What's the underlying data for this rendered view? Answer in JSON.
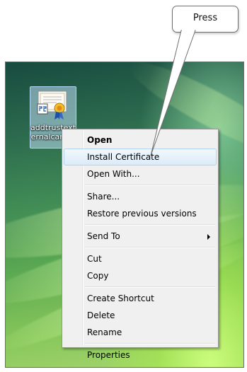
{
  "callout": {
    "text": "Press"
  },
  "desktop_icon": {
    "label": "addtrustexternalcaroot",
    "icon": "certificate-icon"
  },
  "context_menu": {
    "open": "Open",
    "install_certificate": "Install Certificate",
    "open_with": "Open With...",
    "share": "Share...",
    "restore_previous_versions": "Restore previous versions",
    "send_to": "Send To",
    "cut": "Cut",
    "copy": "Copy",
    "create_shortcut": "Create Shortcut",
    "delete": "Delete",
    "rename": "Rename",
    "properties": "Properties",
    "highlighted_item": "Install Certificate",
    "submenu_icon": "chevron-right-icon"
  },
  "colors": {
    "highlight_border": "#b3d3ee",
    "menu_background": "#f0f0f0"
  }
}
